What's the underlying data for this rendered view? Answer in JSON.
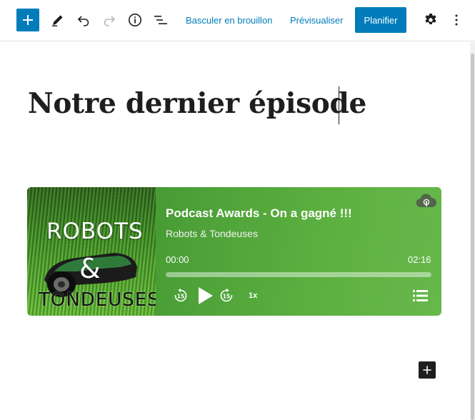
{
  "toolbar": {
    "inserter_icon": "plus-icon",
    "tools_icon": "pencil-icon",
    "undo_icon": "undo-icon",
    "redo_icon": "redo-icon",
    "details_icon": "info-icon",
    "outline_icon": "list-view-icon",
    "draft_label": "Basculer en brouillon",
    "preview_label": "Prévisualiser",
    "schedule_label": "Planifier",
    "settings_icon": "gear-icon",
    "more_icon": "more-vertical-icon",
    "accent_color": "#007cba"
  },
  "post": {
    "title": "Notre dernier épisode"
  },
  "podcast": {
    "cover_words": [
      "ROBOTS",
      "&",
      "TONDEUSES"
    ],
    "episode_title": "Podcast Awards - On a gagné !!!",
    "show_name": "Robots & Tondeuses",
    "current_time": "00:00",
    "duration": "02:16",
    "progress_fraction": 0,
    "speed": "1x",
    "rewind_icon": "rewind-15-icon",
    "play_icon": "play-icon",
    "forward_icon": "forward-15-icon",
    "playlist_icon": "playlist-icon",
    "cloud_icon": "podcast-cloud-icon"
  },
  "editor": {
    "block_add_icon": "plus-icon"
  }
}
